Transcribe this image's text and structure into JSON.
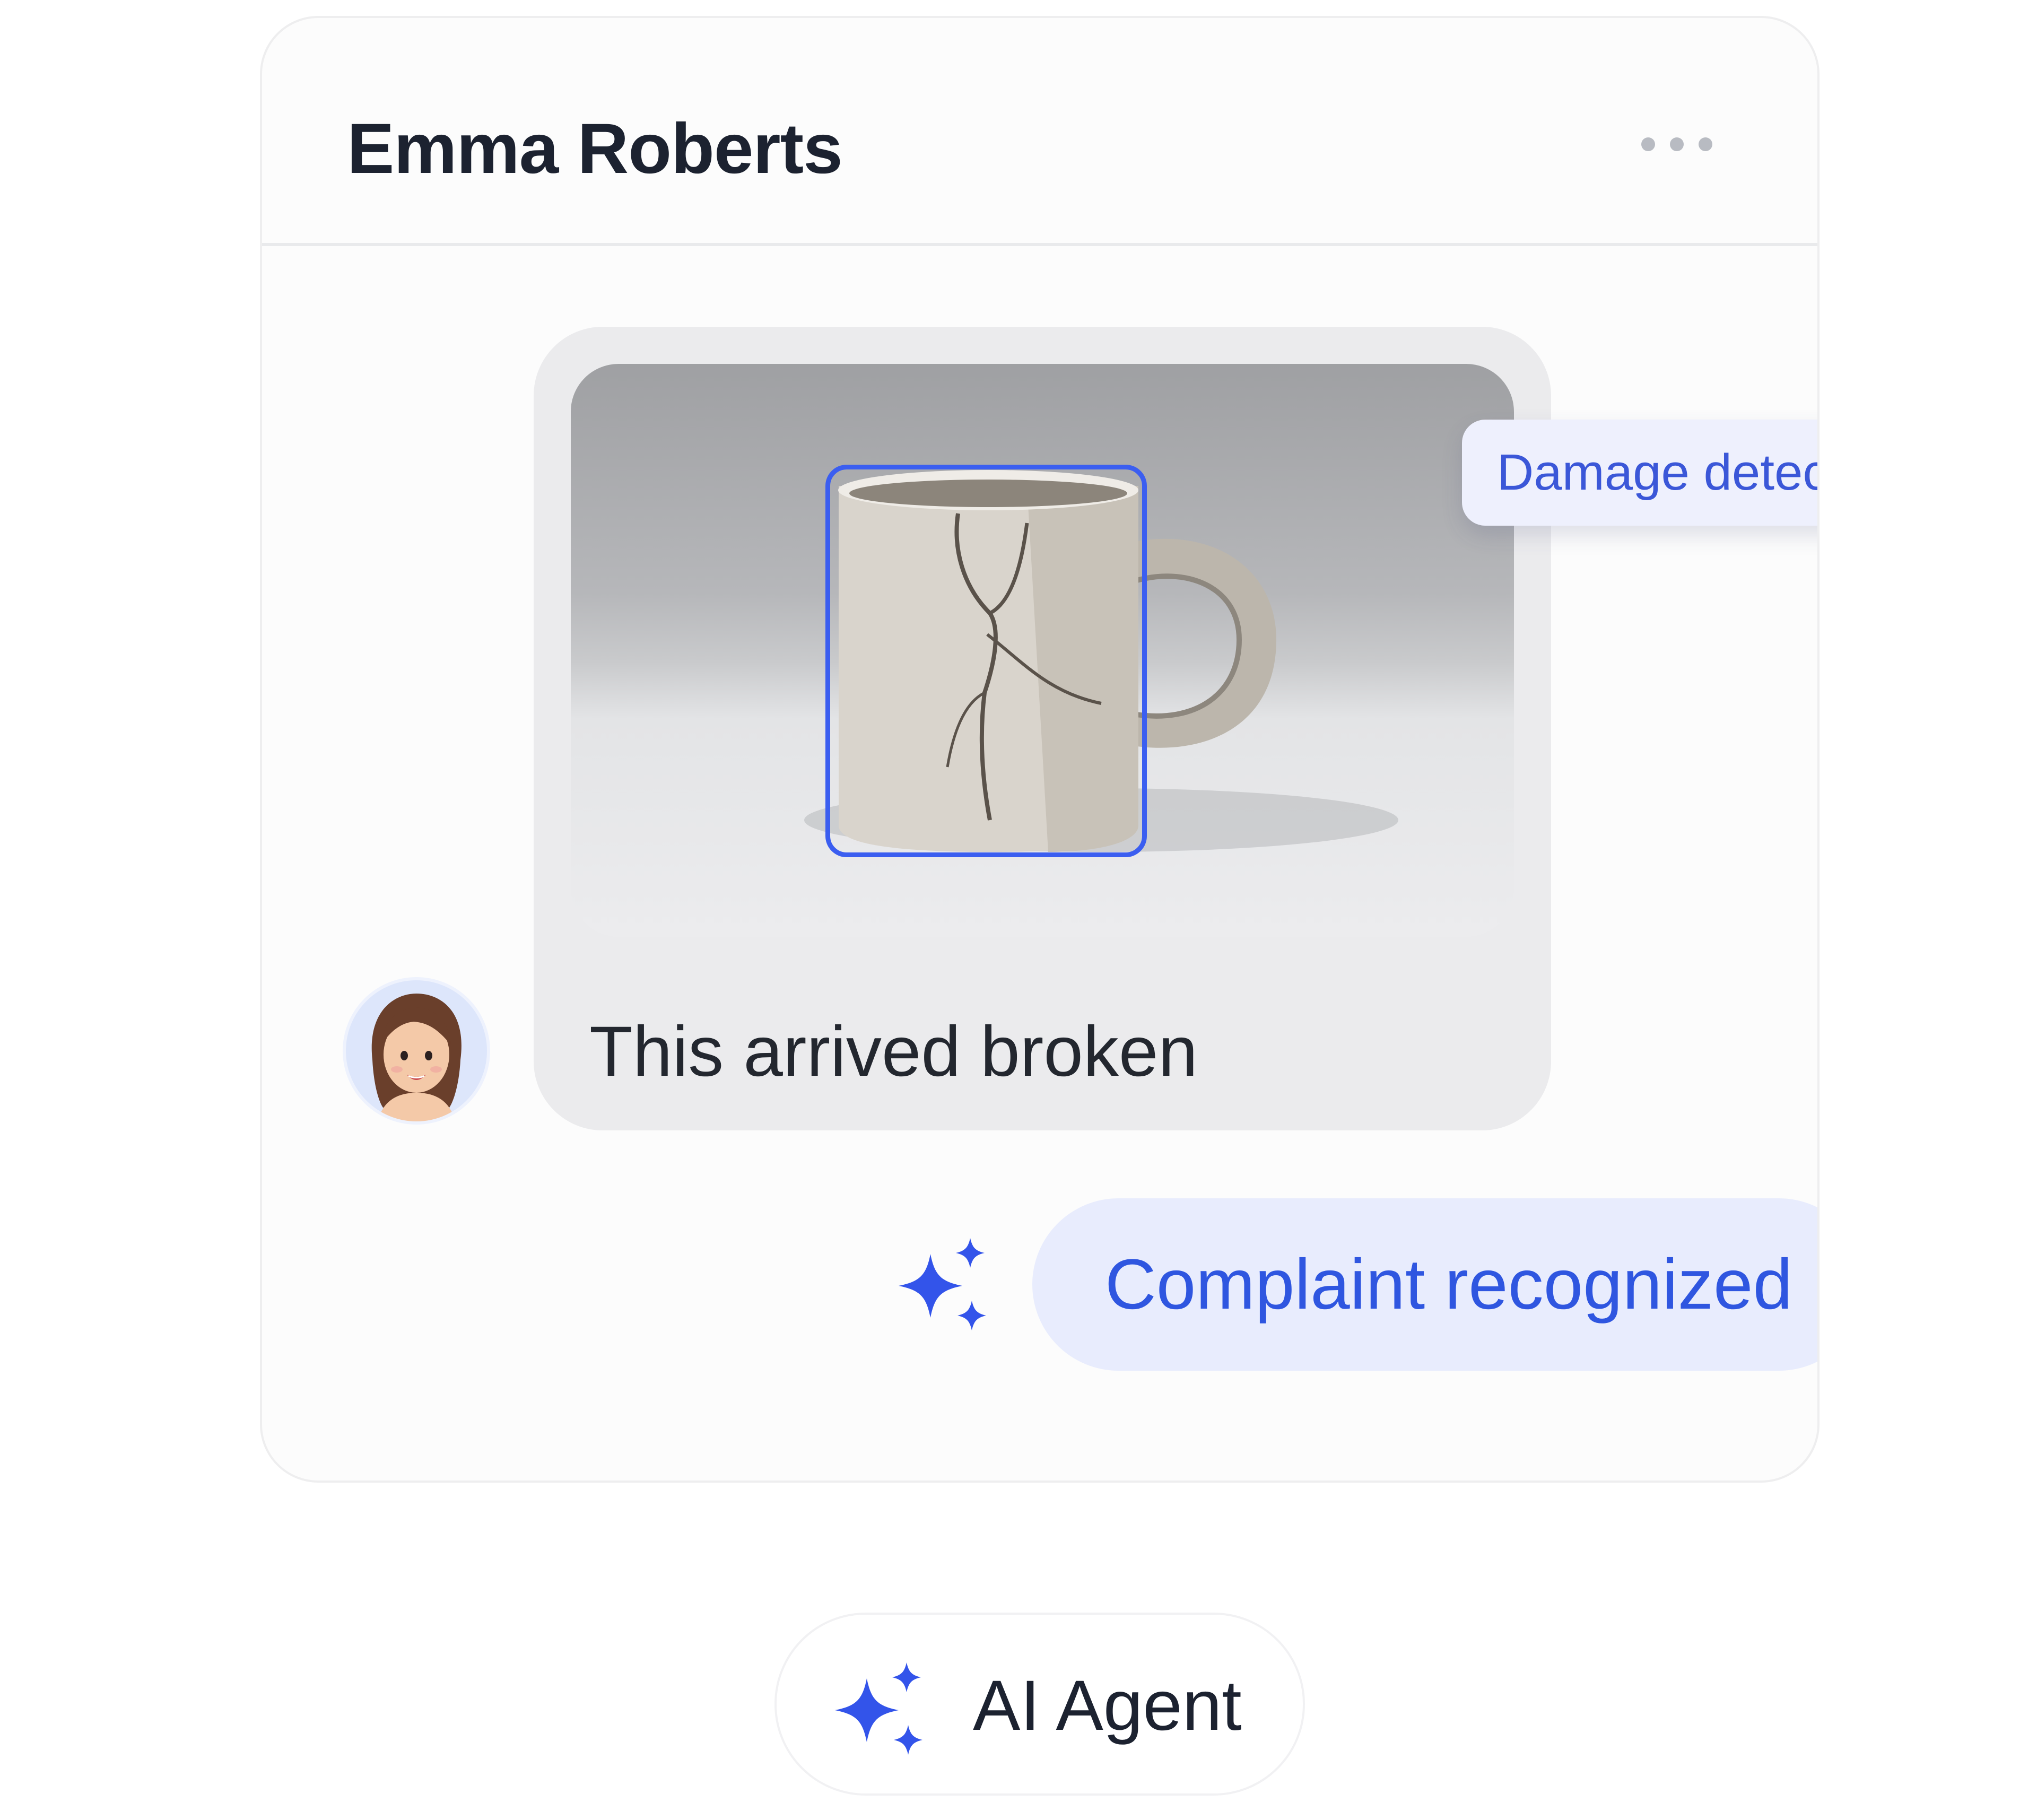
{
  "conversation": {
    "contact_name": "Emma Roberts",
    "more_icon": "more-horizontal-icon"
  },
  "message": {
    "text": "This arrived broken",
    "attachment": {
      "description_icon": "broken-mug-photo",
      "damage_label": "Damage detected"
    },
    "avatar_icon": "woman-avatar"
  },
  "analysis": {
    "status_text": "Complaint recognized",
    "status_icon": "check-circle-icon",
    "sparkle_icon": "sparkles-icon",
    "status_color": "#22a052",
    "accent_color": "#2f56e0"
  },
  "agent": {
    "label": "AI Agent",
    "icon": "sparkles-icon"
  }
}
